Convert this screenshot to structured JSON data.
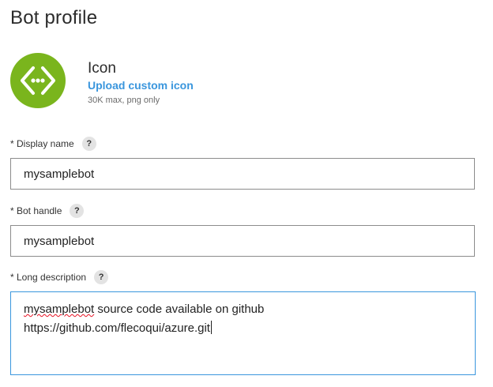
{
  "page": {
    "title": "Bot profile"
  },
  "icon_section": {
    "label": "Icon",
    "upload_link": "Upload custom icon",
    "hint": "30K max, png only",
    "icon_name": "bot-code-icon",
    "icon_color": "#7ab51d"
  },
  "fields": {
    "display_name": {
      "label": "* Display name",
      "help": "?",
      "value": "mysamplebot"
    },
    "bot_handle": {
      "label": "* Bot handle",
      "help": "?",
      "value": "mysamplebot"
    },
    "long_description": {
      "label": "* Long description",
      "help": "?",
      "line1_word": "mysamplebot",
      "line1_rest": " source code available on github",
      "line2": "https://github.com/flecoqui/azure.git"
    }
  },
  "colors": {
    "link": "#3a96dd",
    "focus_border": "#3a96dd",
    "spellcheck": "#e81123"
  }
}
